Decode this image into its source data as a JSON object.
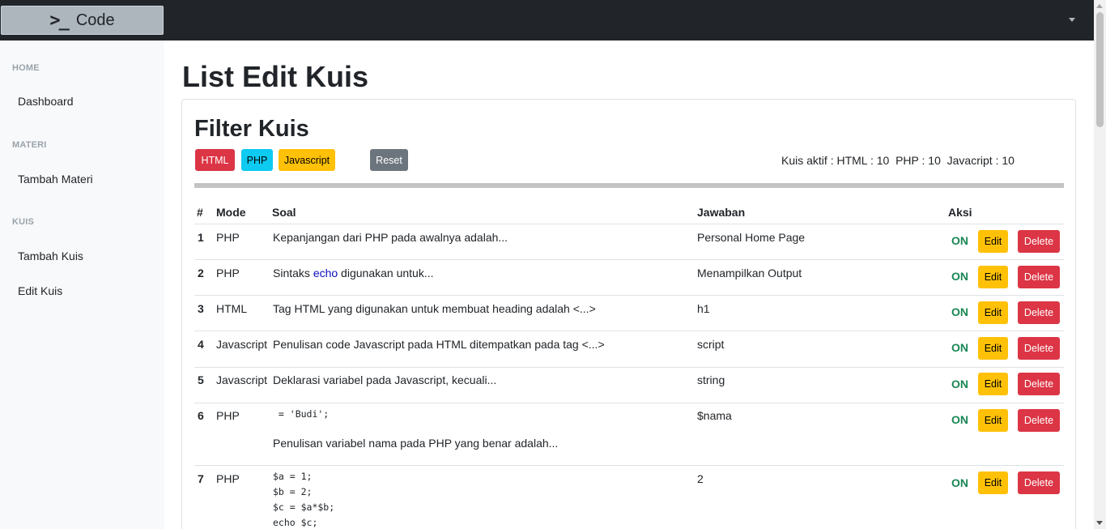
{
  "navbar": {
    "brand_icon": "terminal-icon",
    "brand_label": "Code",
    "dropdown_icon": "caret-down-icon"
  },
  "sidebar": {
    "sections": [
      {
        "heading": "HOME",
        "items": [
          "Dashboard"
        ]
      },
      {
        "heading": "MATERI",
        "items": [
          "Tambah Materi"
        ]
      },
      {
        "heading": "KUIS",
        "items": [
          "Tambah Kuis",
          "Edit Kuis"
        ]
      }
    ]
  },
  "page": {
    "title": "List Edit Kuis"
  },
  "filter": {
    "title": "Filter Kuis",
    "buttons": {
      "html": "HTML",
      "php": "PHP",
      "javascript": "Javascript",
      "reset": "Reset"
    },
    "active_summary": "Kuis aktif : HTML : 10  PHP : 10  Javacript : 10"
  },
  "table": {
    "headers": {
      "num": "#",
      "mode": "Mode",
      "soal": "Soal",
      "jawaban": "Jawaban",
      "aksi": "Aksi"
    },
    "rows": [
      {
        "num": "1",
        "mode": "PHP",
        "soal": "Kepanjangan dari PHP pada awalnya adalah...",
        "jawaban": "Personal Home Page",
        "status": "ON",
        "edit": "Edit",
        "delete": "Delete"
      },
      {
        "num": "2",
        "mode": "PHP",
        "soal_prefix": "Sintaks ",
        "soal_keyword": "echo",
        "soal_suffix": " digunakan untuk...",
        "jawaban": "Menampilkan Output",
        "status": "ON",
        "edit": "Edit",
        "delete": "Delete"
      },
      {
        "num": "3",
        "mode": "HTML",
        "soal": "Tag HTML yang digunakan untuk membuat heading adalah <...>",
        "jawaban": "h1",
        "status": "ON",
        "edit": "Edit",
        "delete": "Delete"
      },
      {
        "num": "4",
        "mode": "Javascript",
        "soal": "Penulisan code Javascript pada HTML ditempatkan pada tag <...>",
        "jawaban": "script",
        "status": "ON",
        "edit": "Edit",
        "delete": "Delete"
      },
      {
        "num": "5",
        "mode": "Javascript",
        "soal": "Deklarasi variabel pada Javascript, kecuali...",
        "jawaban": "string",
        "status": "ON",
        "edit": "Edit",
        "delete": "Delete"
      },
      {
        "num": "6",
        "mode": "PHP",
        "soal_code": " = 'Budi';",
        "soal": "Penulisan variabel nama pada PHP yang benar adalah...",
        "jawaban": "$nama",
        "status": "ON",
        "edit": "Edit",
        "delete": "Delete"
      },
      {
        "num": "7",
        "mode": "PHP",
        "soal_code": "$a = 1;\n$b = 2;\n$c = $a*$b;\necho $c;",
        "jawaban": "2",
        "status": "ON",
        "edit": "Edit",
        "delete": "Delete"
      }
    ]
  }
}
